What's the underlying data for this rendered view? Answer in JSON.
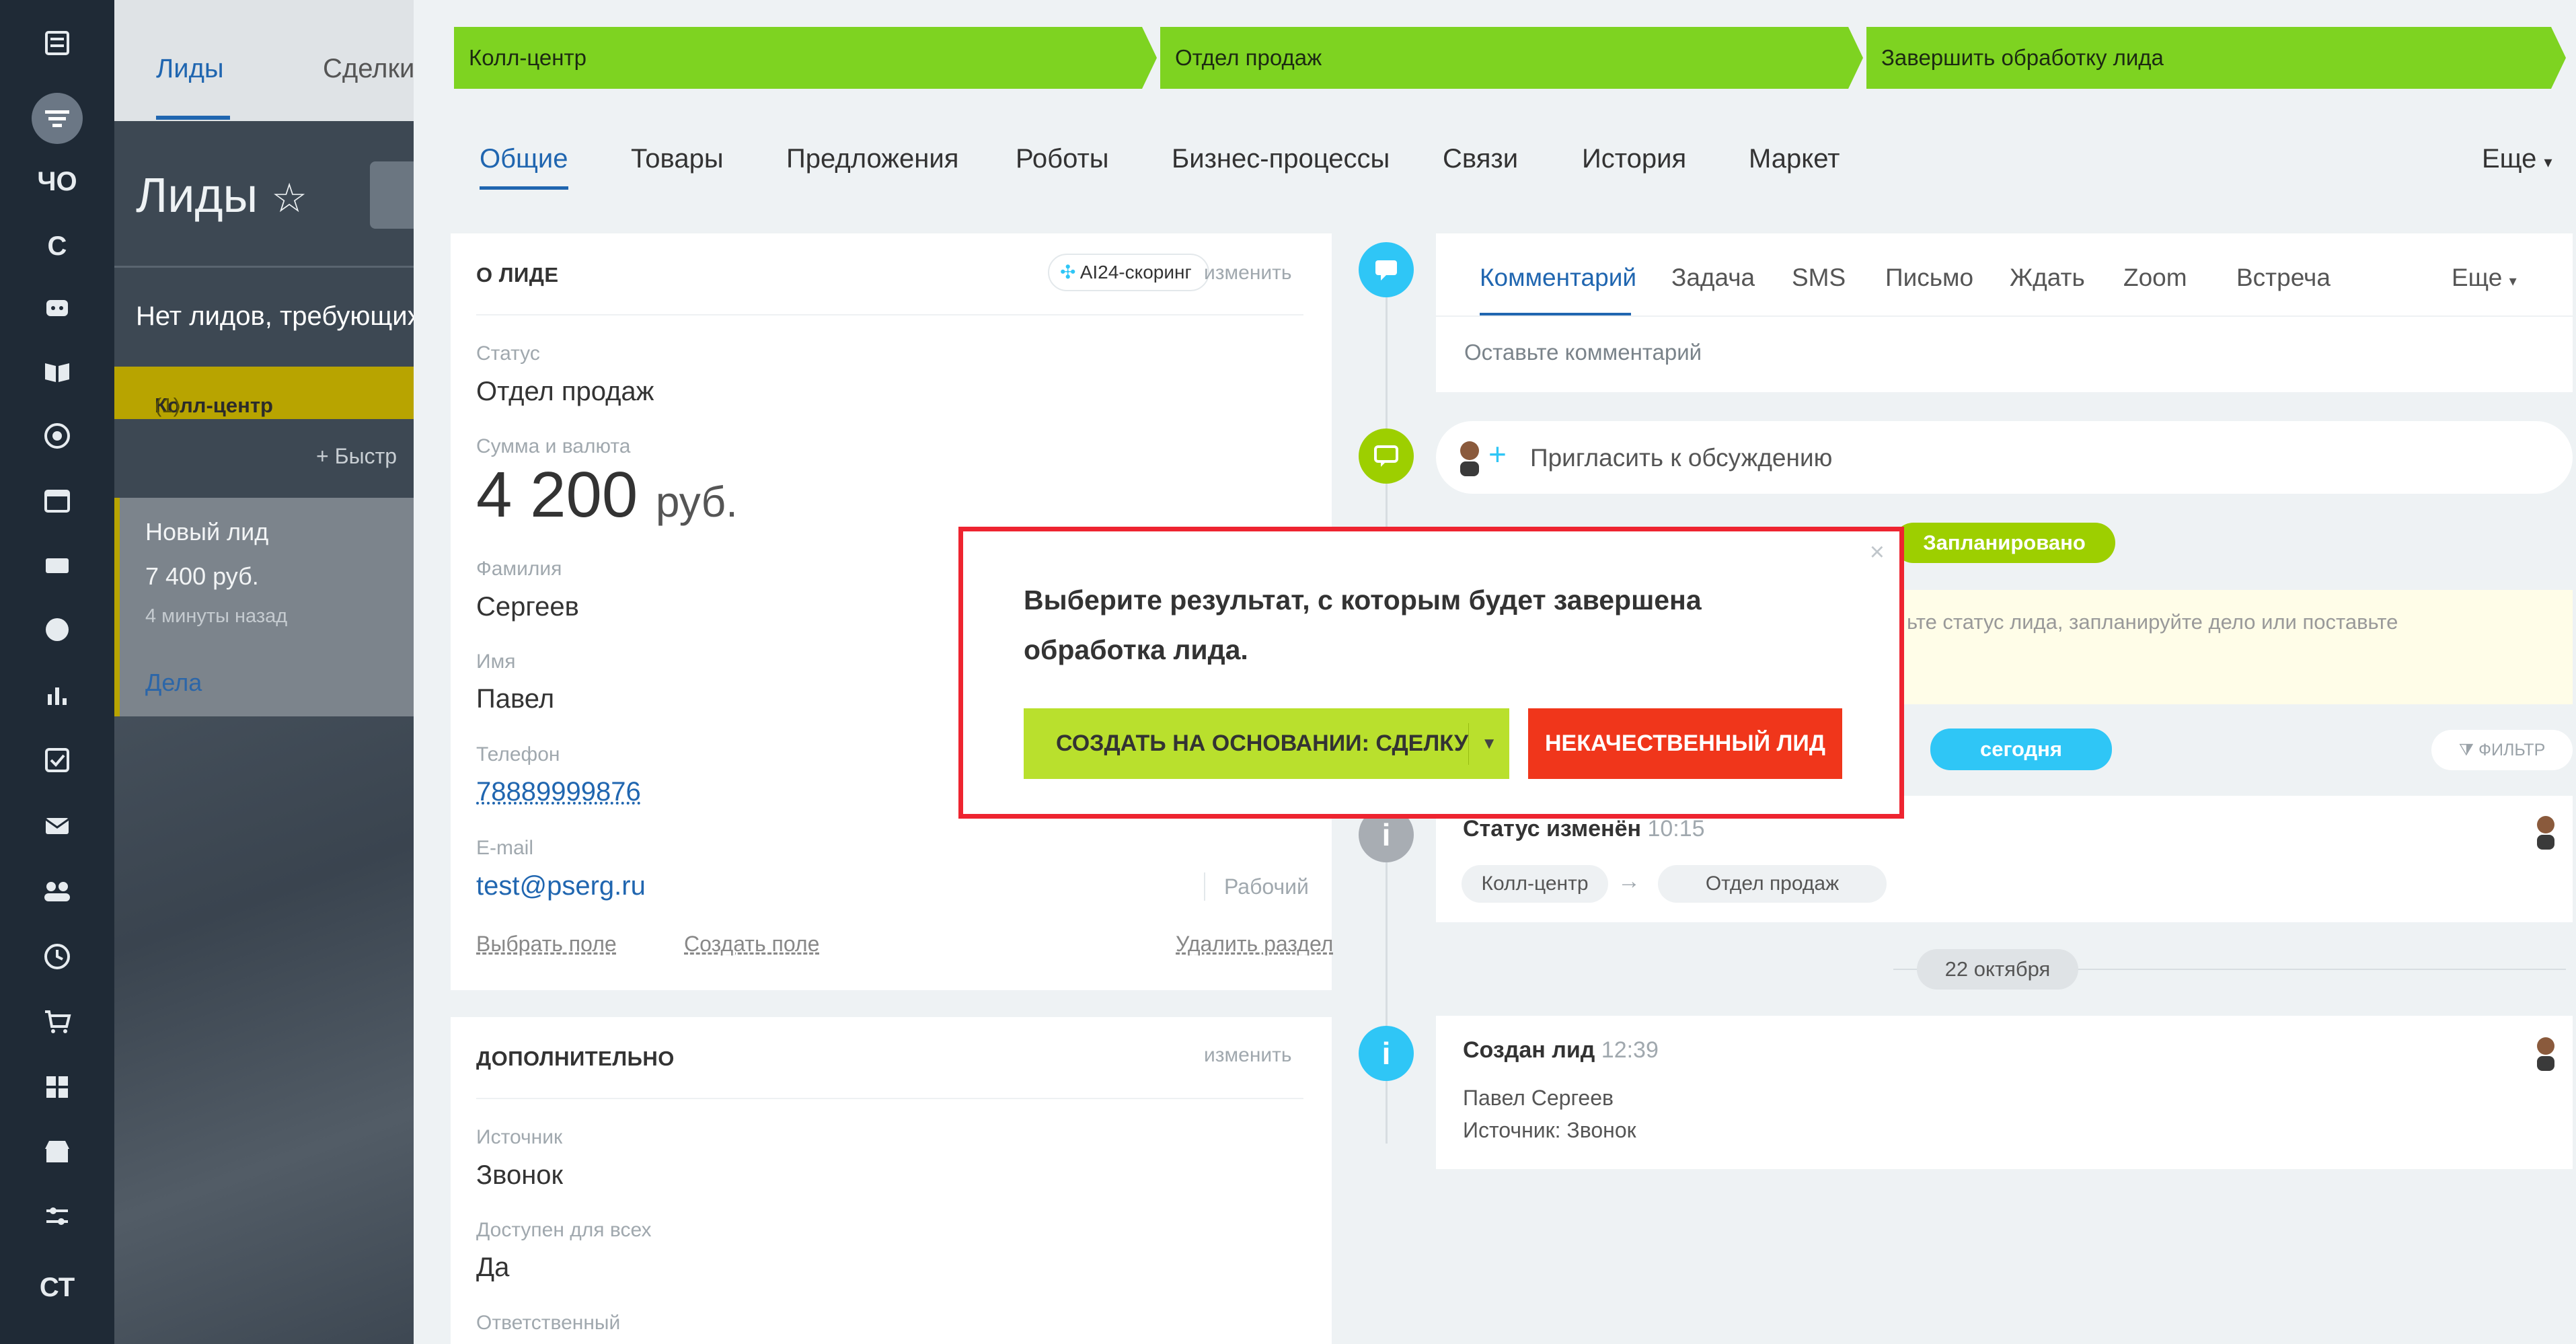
{
  "sidebar_icons": [
    {
      "name": "menu-icon"
    },
    {
      "name": "filter-icon"
    },
    {
      "name": "chat-text",
      "text": "ЧО"
    },
    {
      "name": "c-text",
      "text": "С"
    },
    {
      "name": "robot-icon"
    },
    {
      "name": "book-icon"
    },
    {
      "name": "target-icon"
    },
    {
      "name": "calendar-icon"
    },
    {
      "name": "inbox-icon"
    },
    {
      "name": "clock-icon"
    },
    {
      "name": "chart-icon"
    },
    {
      "name": "check-icon"
    },
    {
      "name": "mail-icon"
    },
    {
      "name": "users-icon"
    },
    {
      "name": "time-icon"
    },
    {
      "name": "cart-icon"
    },
    {
      "name": "grid-icon"
    },
    {
      "name": "store-icon"
    },
    {
      "name": "sliders-icon"
    },
    {
      "name": "ct-text",
      "text": "СТ"
    }
  ],
  "background": {
    "tab_leads": "Лиды",
    "tab_deals": "Сделки",
    "title": "Лиды",
    "star": "☆",
    "no_leads": "Нет лидов, требующих",
    "column_name": "Колл-центр",
    "column_count": "(1)",
    "quick_add": "+ Быстр",
    "card": {
      "title": "Новый лид",
      "amount": "7 400 руб.",
      "time": "4 минуты назад",
      "link": "Дела"
    }
  },
  "stages": [
    "Колл-центр",
    "Отдел продаж",
    "Завершить обработку лида"
  ],
  "tabs": [
    "Общие",
    "Товары",
    "Предложения",
    "Роботы",
    "Бизнес-процессы",
    "Связи",
    "История",
    "Маркет"
  ],
  "tabs_more": "Еще",
  "about": {
    "section_title": "О ЛИДЕ",
    "scoring": "AI24-скоринг",
    "edit": "изменить",
    "status_label": "Статус",
    "status_value": "Отдел продаж",
    "sum_label": "Сумма и валюта",
    "sum_value": "4 200",
    "sum_currency": "руб.",
    "lastname_label": "Фамилия",
    "lastname_value": "Сергеев",
    "name_label": "Имя",
    "name_value": "Павел",
    "phone_label": "Телефон",
    "phone_value": "78889999876",
    "email_label": "E-mail",
    "email_value": "test@pserg.ru",
    "email_type": "Рабочий",
    "select_field": "Выбрать поле",
    "create_field": "Создать поле",
    "delete_section": "Удалить раздел"
  },
  "extra": {
    "section_title": "ДОПОЛНИТЕЛЬНО",
    "edit": "изменить",
    "source_label": "Источник",
    "source_value": "Звонок",
    "available_label": "Доступен для всех",
    "available_value": "Да",
    "responsible_label": "Ответственный"
  },
  "activity": {
    "tabs": [
      "Комментарий",
      "Задача",
      "SMS",
      "Письмо",
      "Ждать",
      "Zoom",
      "Встреча"
    ],
    "more": "Еще",
    "placeholder": "Оставьте комментарий",
    "invite": "Пригласить к обсуждению"
  },
  "timeline": {
    "planned": "Запланировано",
    "planned_hint": "ьте статус лида, запланируйте дело или поставьте",
    "today": "сегодня",
    "filter": "ФИЛЬТР",
    "status_changed_title": "Статус изменён",
    "status_changed_time": "10:15",
    "from_stage": "Колл-центр",
    "arrow": "→",
    "to_stage": "Отдел продаж",
    "date_divider": "22 октября",
    "created_title": "Создан лид",
    "created_time": "12:39",
    "created_name": "Павел Сергеев",
    "created_source": "Источник: Звонок"
  },
  "popup": {
    "message": "Выберите результат, с которым будет завершена обработка лида.",
    "btn_deal": "СОЗДАТЬ НА ОСНОВАНИИ: СДЕЛКУ",
    "btn_bad": "НЕКАЧЕСТВЕННЫЙ ЛИД",
    "close": "×"
  },
  "colors": {
    "stage_green": "#7ed321",
    "primary_blue": "#2066b0",
    "timeline_blue": "#2fc6f6",
    "red_border": "#ee2430",
    "bad_button": "#f0361b",
    "deal_button": "#b9e02d"
  }
}
